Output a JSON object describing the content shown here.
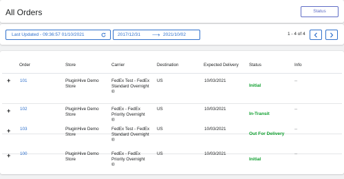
{
  "header": {
    "title": "All Orders",
    "status_button": "Status"
  },
  "toolbar": {
    "last_updated": "Last Updated - 09:36:57 01/10/2021",
    "date_start": "2017/12/31",
    "date_arrow": "⟶",
    "date_end": "2021/10/02",
    "pager_text": "1 - 4 of 4",
    "prev_icon": "chevron-left-icon",
    "next_icon": "chevron-right-icon"
  },
  "table": {
    "columns": {
      "order": "Order",
      "store": "Store",
      "carrier": "Carrier",
      "destination": "Destination",
      "expected": "Expected Delivery",
      "status": "Status",
      "info": "Info"
    },
    "rows": [
      {
        "expand": "+",
        "order": "101",
        "store_1": "PluginHive Demo",
        "store_2": "Store",
        "carrier_1": "FedEx Test - FedEx",
        "carrier_2": "Standard Overnight",
        "carrier_3": "®",
        "destination": "US",
        "expected": "10/03/2021",
        "status": "Initial",
        "info": "--"
      },
      {
        "expand": "+",
        "order": "102",
        "store_1": "PluginHive Demo",
        "store_2": "Store",
        "carrier_1": "FedEx - FedEx",
        "carrier_2": "Priority Overnight",
        "carrier_3": "®",
        "destination": "US",
        "expected": "10/03/2021",
        "status": "In-Transit",
        "info": "--"
      },
      {
        "expand": "+",
        "order": "103",
        "store_1": "PluginHive Demo",
        "store_2": "Store",
        "carrier_1": "FedEx Test - FedEx",
        "carrier_2": "Standard Overnight",
        "carrier_3": "®",
        "destination": "US",
        "expected": "10/03/2021",
        "status": "Out For Delivery",
        "info": "--"
      },
      {
        "expand": "+",
        "order": "100",
        "store_1": "PluginHive Demo",
        "store_2": "Store",
        "carrier_1": "FedEx - FedEx",
        "carrier_2": "Priority Overnight",
        "carrier_3": "®",
        "destination": "US",
        "expected": "10/03/2021",
        "status": "Initial",
        "info": "--"
      }
    ]
  },
  "colors": {
    "accent": "#2c6ecb",
    "status_green": "#0c9e2c",
    "background": "#f1f2f3"
  }
}
